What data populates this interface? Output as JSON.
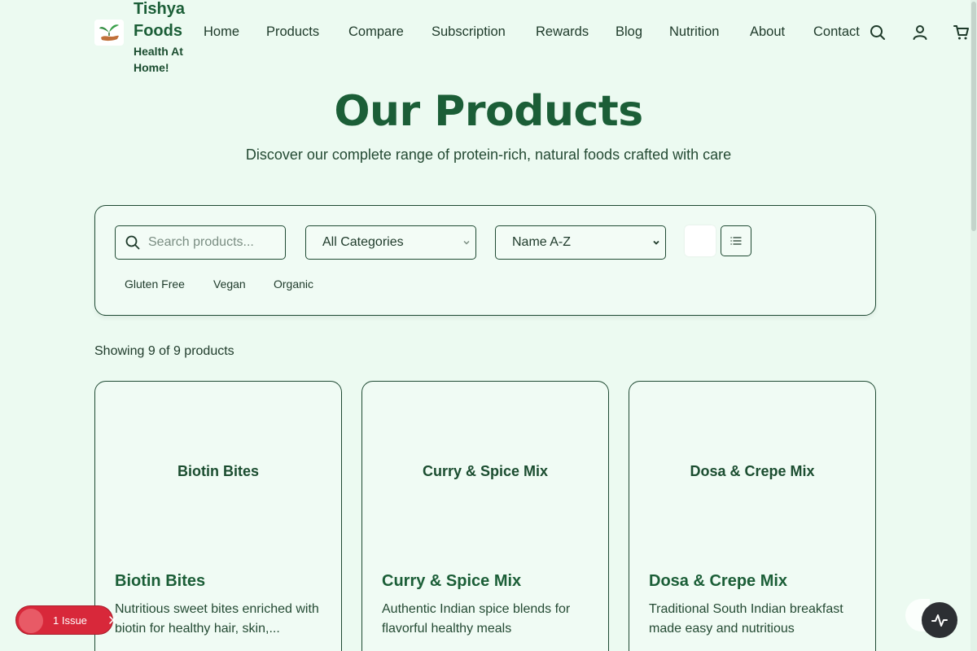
{
  "brand": {
    "name": "Tishya Foods",
    "tagline": "Health At Home!"
  },
  "nav": [
    "Home",
    "Products",
    "Compare",
    "Subscription",
    "Rewards",
    "Blog",
    "Nutrition",
    "About",
    "Contact"
  ],
  "header_icons": [
    "search-icon",
    "user-icon",
    "cart-icon"
  ],
  "page": {
    "title": "Our Products",
    "subtitle": "Discover our complete range of protein-rich, natural foods crafted with care"
  },
  "filters": {
    "search_placeholder": "Search products...",
    "category_selected": "All Categories",
    "sort_selected": "Name A-Z",
    "chips": [
      "Gluten Free",
      "Vegan",
      "Organic"
    ]
  },
  "results_text": "Showing 9 of 9 products",
  "products": [
    {
      "image_label": "Biotin Bites",
      "name": "Biotin Bites",
      "description": "Nutritious sweet bites enriched with biotin for healthy hair, skin,..."
    },
    {
      "image_label": "Curry & Spice Mix",
      "name": "Curry & Spice Mix",
      "description": "Authentic Indian spice blends for flavorful healthy meals"
    },
    {
      "image_label": "Dosa & Crepe Mix",
      "name": "Dosa & Crepe Mix",
      "description": "Traditional South Indian breakfast made easy and nutritious"
    }
  ],
  "issue_badge": "1 Issue",
  "colors": {
    "brand_green": "#1b5e37",
    "background": "#ecfaf1",
    "issue_red": "#d8283a"
  }
}
